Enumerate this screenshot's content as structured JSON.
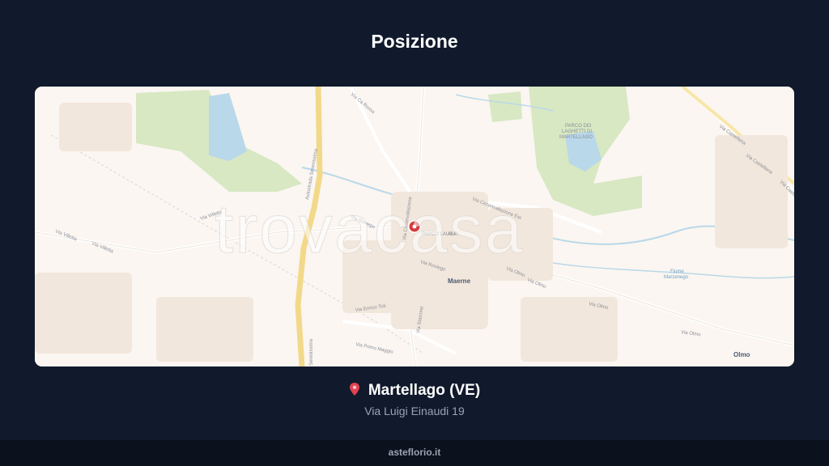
{
  "header": {
    "title": "Posizione"
  },
  "map": {
    "watermark": "trovacasa",
    "labels": {
      "autostrada": "Autostrada Serenissima",
      "serenissima_bottom": "Serenissima",
      "via_ca_rossa": "Via Ca Rossa",
      "via_villetta_1": "Via Villetta",
      "via_villetta_2": "Via Villetta",
      "via_roviego_1": "Via Roviego",
      "via_roviego_2": "Via Roviego",
      "via_circonvallazione_1": "Via Circonvallazione",
      "via_circonvallazione_2": "Via Circonvallazione Est",
      "via_olmo_1": "Via Olmo",
      "via_olmo_2": "Via Olmo",
      "via_olmo_3": "Via Olmo",
      "via_olmo_4": "Via Olmo",
      "via_enrico_toti": "Via Enrico Toti",
      "via_primo_maggio": "Via Primo Maggio",
      "via_castellana_1": "Via Castellana",
      "via_castellana_2": "Via Castellana",
      "via_castellana_3": "Via Castellana",
      "via_stazione": "Via Stazione",
      "parco_laghetti_1": "PARCO DEI",
      "parco_laghetti_2": "LAGHETTI DI",
      "parco_laghetti_3": "MARTELLAGO",
      "parco_laura_1": "PARCO LAURA",
      "parco_laura_2": "ALPI",
      "fiume_1": "Fiume",
      "fiume_2": "Marzenego",
      "place_maerne": "Maerne",
      "place_olmo": "Olmo"
    },
    "colors": {
      "background": "#fbf6f1",
      "park": "#d7e8c3",
      "water": "#b9d8ea",
      "highway": "#f2d98a",
      "marker": "#d63a3f"
    }
  },
  "location": {
    "pin_icon": "map-pin-icon",
    "city": "Martellago (VE)",
    "address": "Via Luigi Einaudi 19"
  },
  "footer": {
    "site": "asteflorio.it"
  }
}
